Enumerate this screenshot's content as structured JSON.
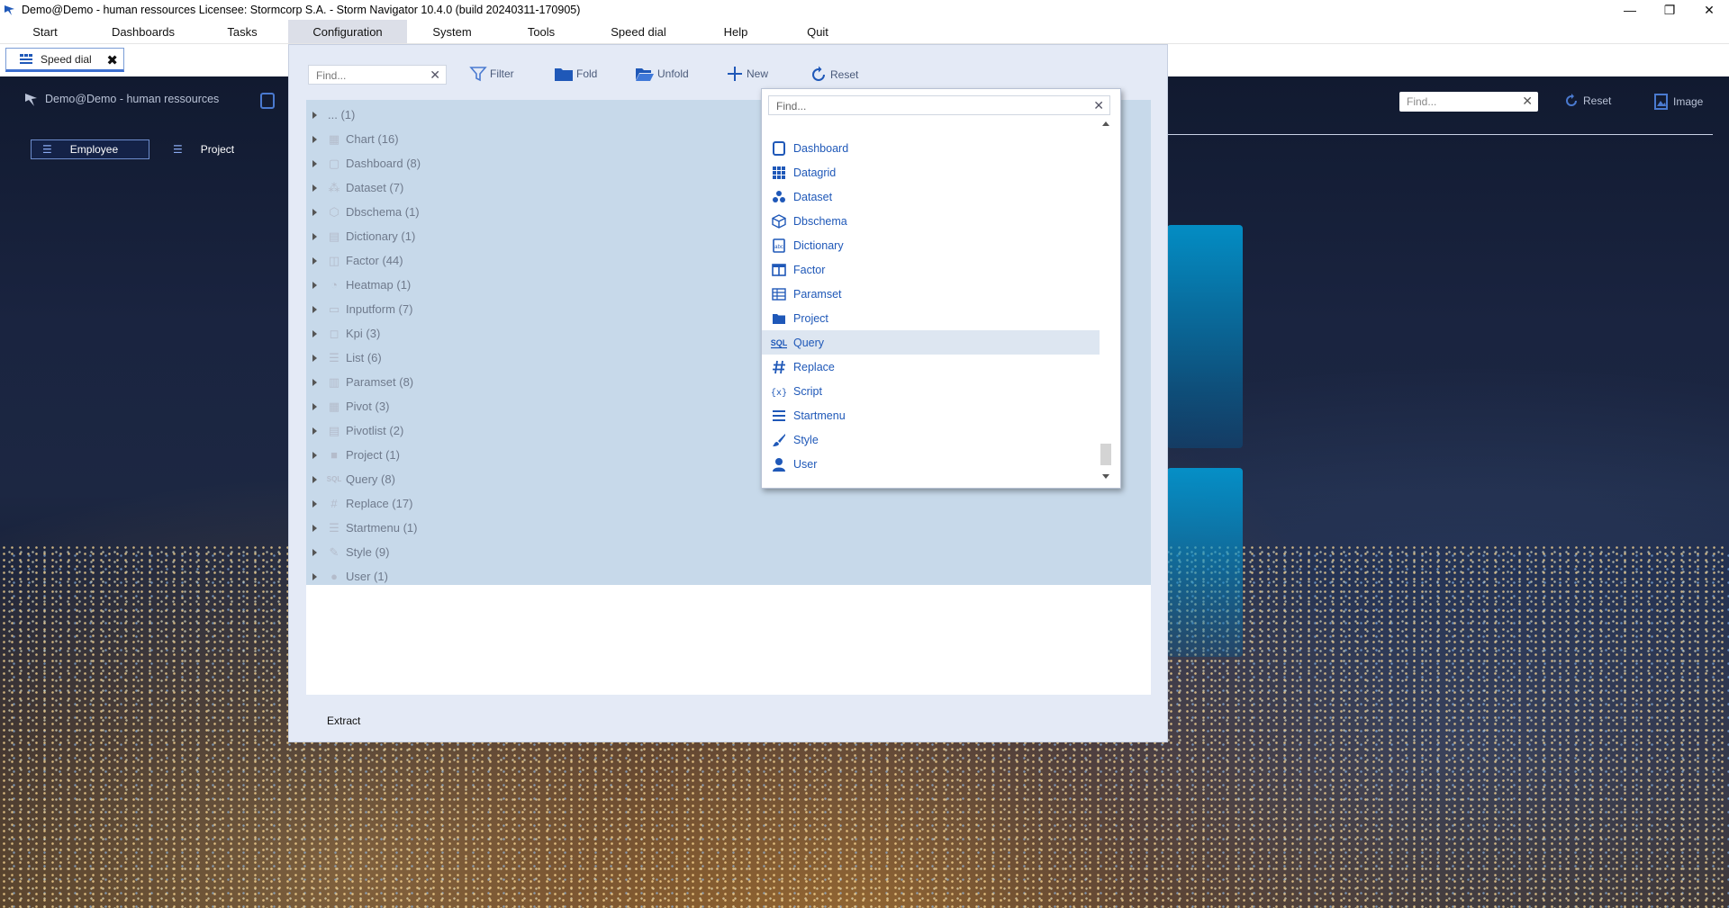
{
  "titlebar": {
    "title": "Demo@Demo - human ressources   Licensee: Stormcorp S.A. - Storm Navigator 10.4.0 (build 20240311-170905)",
    "minimize": "—",
    "restore": "❐",
    "close": "✕"
  },
  "menu": {
    "items": [
      {
        "label": "Start"
      },
      {
        "label": "Dashboards"
      },
      {
        "label": "Tasks"
      },
      {
        "label": "Configuration"
      },
      {
        "label": "System"
      },
      {
        "label": "Tools"
      },
      {
        "label": "Speed dial"
      },
      {
        "label": "Help"
      },
      {
        "label": "Quit"
      }
    ]
  },
  "tabstrip": {
    "tab_label": "Speed dial",
    "tab_close": "✖"
  },
  "background": {
    "title": "Demo@Demo - human ressources",
    "reset_label": "Reset",
    "image_label": "Image",
    "find_placeholder": "Find...",
    "find_clear": "✕",
    "tabs": [
      {
        "label": "Employee"
      },
      {
        "label": "Project"
      }
    ],
    "hamburger": "☰"
  },
  "config": {
    "find_placeholder": "Find...",
    "find_clear": "✕",
    "toolbar": {
      "filter": "Filter",
      "fold": "Fold",
      "unfold": "Unfold",
      "new": "New",
      "reset": "Reset"
    },
    "tree": [
      {
        "label": "... (1)",
        "icon": ""
      },
      {
        "label": "Chart (16)",
        "icon": "chart-icon"
      },
      {
        "label": "Dashboard (8)",
        "icon": "dashboard-icon"
      },
      {
        "label": "Dataset (7)",
        "icon": "dataset-icon"
      },
      {
        "label": "Dbschema (1)",
        "icon": "dbschema-icon"
      },
      {
        "label": "Dictionary (1)",
        "icon": "dictionary-icon"
      },
      {
        "label": "Factor (44)",
        "icon": "factor-icon"
      },
      {
        "label": "Heatmap (1)",
        "icon": "heatmap-icon"
      },
      {
        "label": "Inputform (7)",
        "icon": "inputform-icon"
      },
      {
        "label": "Kpi (3)",
        "icon": "kpi-icon"
      },
      {
        "label": "List (6)",
        "icon": "list-icon"
      },
      {
        "label": "Paramset (8)",
        "icon": "paramset-icon"
      },
      {
        "label": "Pivot (3)",
        "icon": "pivot-icon"
      },
      {
        "label": "Pivotlist (2)",
        "icon": "pivotlist-icon"
      },
      {
        "label": "Project (1)",
        "icon": "folder-icon"
      },
      {
        "label": "Query (8)",
        "icon": "query-icon"
      },
      {
        "label": "Replace (17)",
        "icon": "hash-icon"
      },
      {
        "label": "Startmenu (1)",
        "icon": "menu-icon"
      },
      {
        "label": "Style (9)",
        "icon": "brush-icon"
      },
      {
        "label": "User (1)",
        "icon": "user-icon"
      }
    ],
    "extract_label": "Extract"
  },
  "new_dropdown": {
    "find_placeholder": "Find...",
    "find_clear": "✕",
    "items": [
      {
        "label": "Dashboard",
        "icon": "dashboard-icon"
      },
      {
        "label": "Datagrid",
        "icon": "datagrid-icon"
      },
      {
        "label": "Dataset",
        "icon": "dataset-icon"
      },
      {
        "label": "Dbschema",
        "icon": "dbschema-icon"
      },
      {
        "label": "Dictionary",
        "icon": "dictionary-icon"
      },
      {
        "label": "Factor",
        "icon": "factor-icon"
      },
      {
        "label": "Paramset",
        "icon": "paramset-icon"
      },
      {
        "label": "Project",
        "icon": "folder-icon"
      },
      {
        "label": "Query",
        "icon": "query-icon",
        "highlighted": true
      },
      {
        "label": "Replace",
        "icon": "hash-icon"
      },
      {
        "label": "Script",
        "icon": "script-icon"
      },
      {
        "label": "Startmenu",
        "icon": "menu-icon"
      },
      {
        "label": "Style",
        "icon": "brush-icon"
      },
      {
        "label": "User",
        "icon": "user-icon"
      }
    ]
  },
  "colors": {
    "accent": "#1f58b8",
    "panel_bg": "#e4eaf6",
    "tree_selection": "#c7d9ea",
    "menu_active": "#dcdfe8"
  }
}
